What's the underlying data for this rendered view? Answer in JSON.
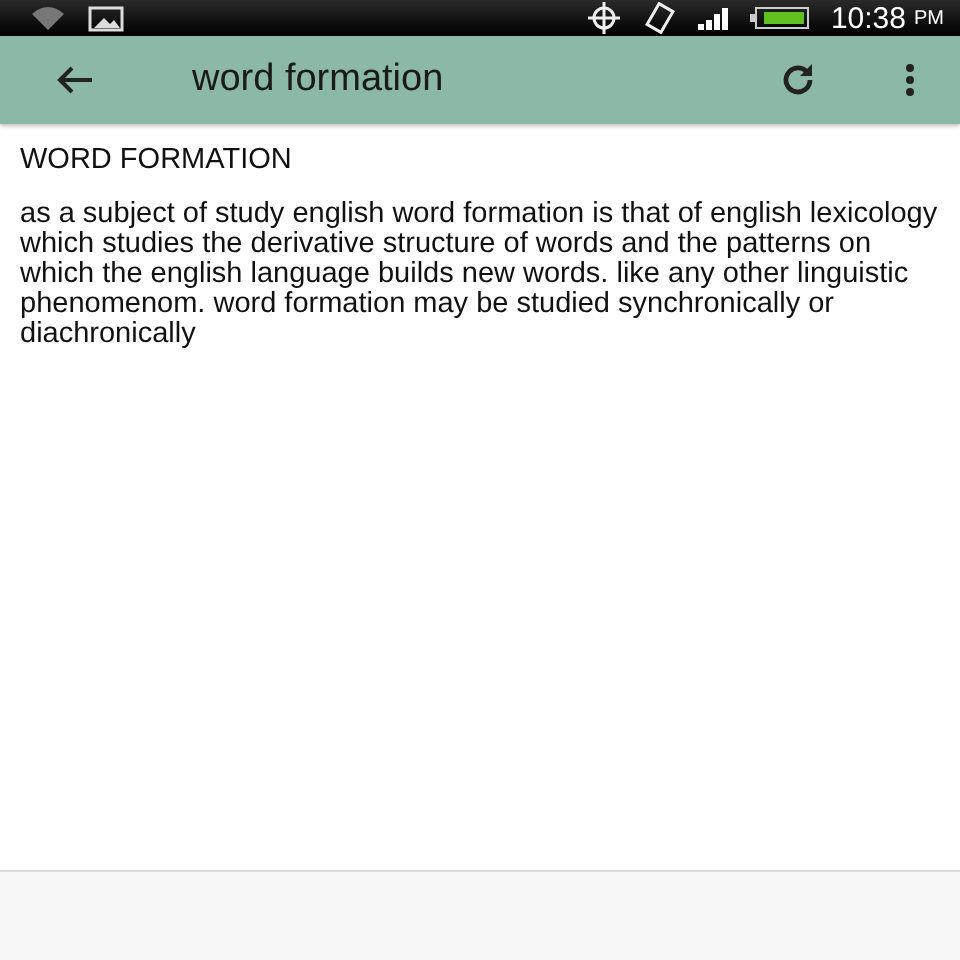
{
  "status_bar": {
    "time": "10:38",
    "ampm": "PM"
  },
  "toolbar": {
    "title": "word formation"
  },
  "content": {
    "heading": "WORD FORMATION",
    "paragraph": "as a subject of study english word formation is that of english lexicology which studies the derivative structure of words and the patterns on which the english language builds new words. like any other linguistic phenomenom. word formation may be studied synchronically or diachronically"
  }
}
